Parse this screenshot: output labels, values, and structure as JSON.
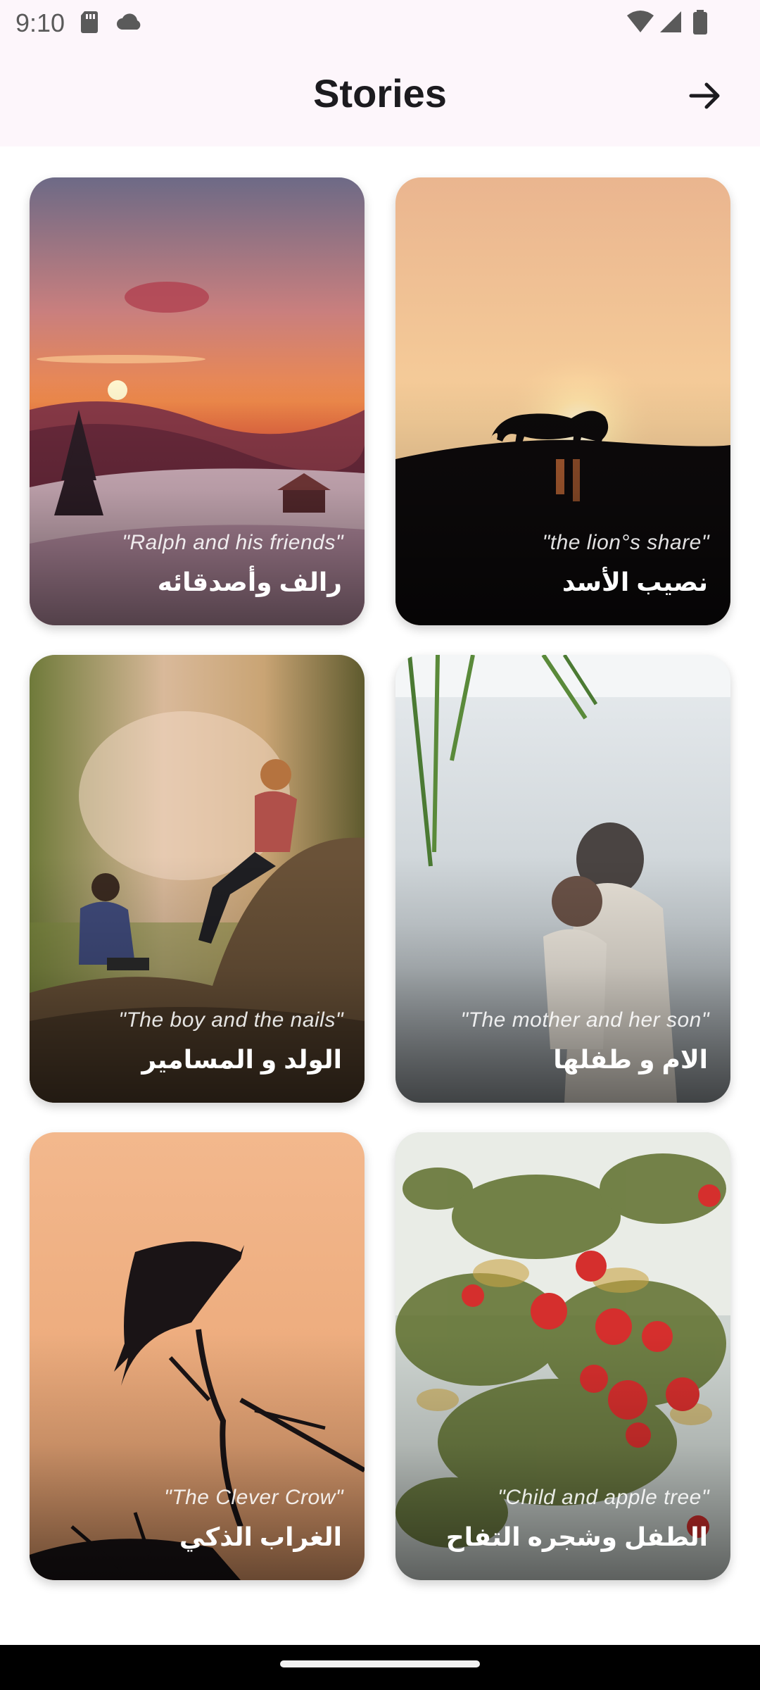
{
  "status": {
    "time": "9:10",
    "left_icons": [
      "sd-card-icon",
      "cloud-icon"
    ],
    "right_icons": [
      "wifi-icon",
      "signal-icon",
      "battery-icon"
    ]
  },
  "appbar": {
    "title": "Stories",
    "action_icon": "arrow-right-icon"
  },
  "stories": [
    {
      "english": "\"Ralph and his friends\"",
      "arabic": "رالف وأصدقائه"
    },
    {
      "english": "\"the lion°s share\"",
      "arabic": "نصيب الأسد"
    },
    {
      "english": "\"The boy and the nails\"",
      "arabic": "الولد و المسامير"
    },
    {
      "english": "\"The mother and her son\"",
      "arabic": "الام و طفلها"
    },
    {
      "english": "\"The Clever Crow\"",
      "arabic": "الغراب الذكي"
    },
    {
      "english": "\"Child and apple tree\"",
      "arabic": "الطفل وشجره التفاح"
    }
  ],
  "colors": {
    "bar_background": "#fdf6fb",
    "title": "#1c1b1f",
    "card_text": "#ffffff"
  }
}
